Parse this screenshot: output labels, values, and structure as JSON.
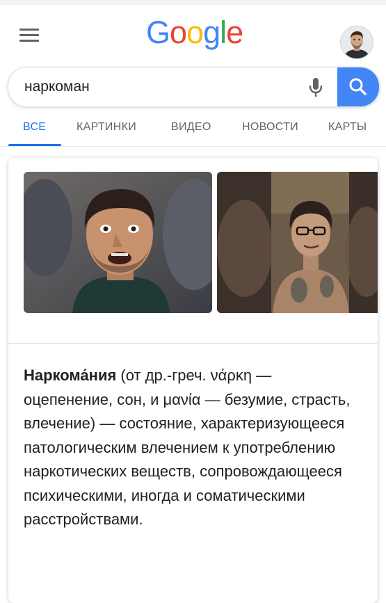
{
  "header": {
    "logo_letters": [
      "G",
      "o",
      "o",
      "g",
      "l",
      "e"
    ],
    "menu_icon": "hamburger-menu-icon",
    "avatar_icon": "user-avatar"
  },
  "search": {
    "query": "наркоман",
    "mic_icon": "microphone-icon",
    "search_icon": "search-icon"
  },
  "tabs": [
    {
      "label": "ВСЕ",
      "active": true
    },
    {
      "label": "КАРТИНКИ",
      "active": false
    },
    {
      "label": "ВИДЕО",
      "active": false
    },
    {
      "label": "НОВОСТИ",
      "active": false
    },
    {
      "label": "КАРТЫ",
      "active": false
    }
  ],
  "knowledge_panel": {
    "term": "Наркома́ния",
    "definition": " (от др.-греч. νάρκη — оцепенение, сон, и μανία — безумие, страсть, влечение) — состояние, характеризующееся патологическим влечением к употреблению наркотических веществ, сопровождающееся психическими, иногда и соматическими расстройствами."
  },
  "colors": {
    "google_blue": "#4285F4",
    "google_red": "#EA4335",
    "google_yellow": "#FBBC05",
    "google_green": "#34A853",
    "active_tab": "#1a73e8"
  }
}
